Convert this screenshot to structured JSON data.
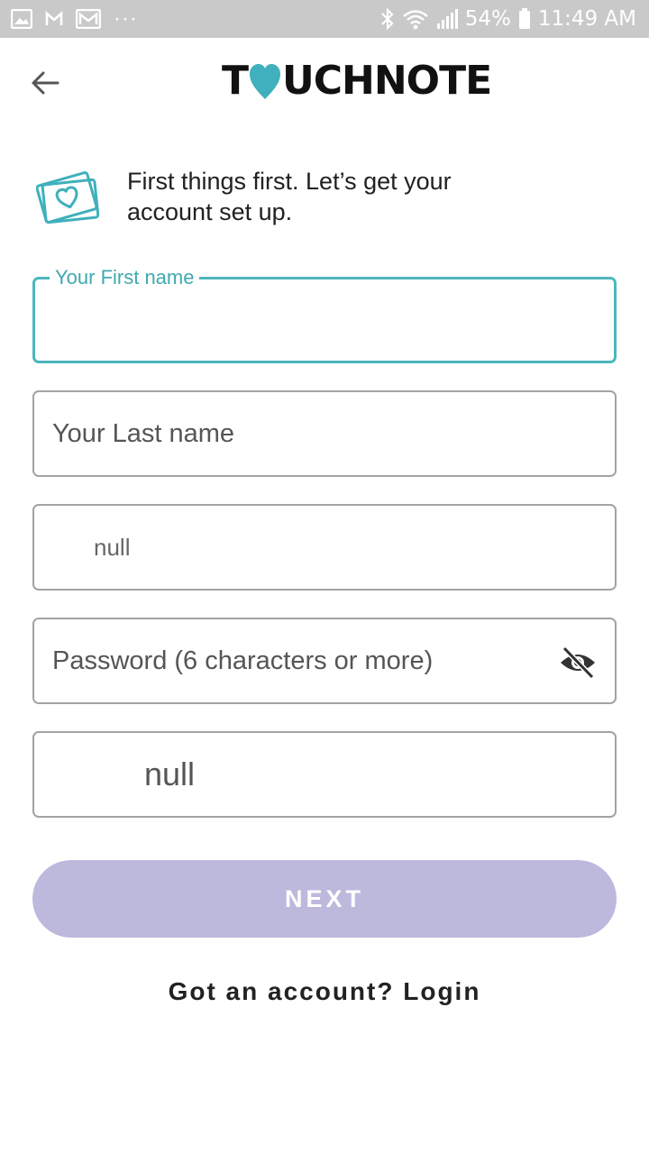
{
  "status_bar": {
    "battery": "54%",
    "time": "11:49 AM",
    "left_icons": [
      "gallery-icon",
      "gmail-icon",
      "mail-icon",
      "more-dots-icon"
    ],
    "right_icons": [
      "bluetooth-icon",
      "wifi-icon",
      "signal-icon",
      "battery-icon"
    ]
  },
  "header": {
    "logo": "TOUCHNOTE",
    "back_icon": "arrow-left-icon"
  },
  "intro": {
    "text": "First things first. Let’s get your account set up.",
    "icon": "postcards-heart-icon"
  },
  "form": {
    "first_name_label": "Your First name",
    "first_name_value": "",
    "last_name_placeholder": "Your Last name",
    "email_value": "null",
    "password_placeholder": "Password (6 characters or more)",
    "password_toggle_icon": "eye-off-icon",
    "fifth_field_value": "null"
  },
  "next_label": "NEXT",
  "login_text": "Got an account? Login",
  "colors": {
    "accent": "#4db6bd",
    "button_disabled": "#bdb9dd",
    "status_bar": "#c9c9c9"
  }
}
